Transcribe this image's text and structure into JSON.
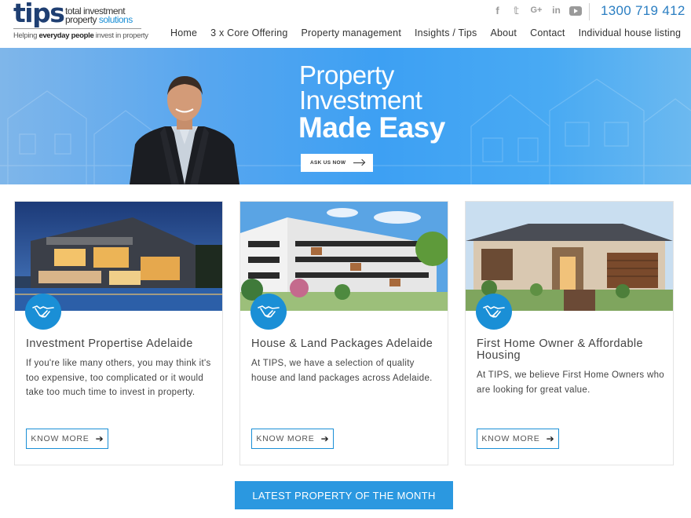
{
  "brand": {
    "logo_word": "tips",
    "logo_line1": "total investment",
    "logo_line2a": "property ",
    "logo_line2b": "solutions",
    "tagline_pre": "Helping ",
    "tagline_bold": "everyday people",
    "tagline_post": " invest in property",
    "accent_color": "#1a8fd6",
    "navy_color": "#1f3f72"
  },
  "social": [
    "facebook-icon",
    "twitter-icon",
    "google-plus-icon",
    "linkedin-icon",
    "youtube-icon"
  ],
  "social_glyphs": {
    "facebook": "f",
    "twitter": "𝕥",
    "google": "G+",
    "linkedin": "in"
  },
  "phone": "1300 719 412",
  "nav": {
    "items": [
      "Home",
      "3 x Core Offering",
      "Property management",
      "Insights / Tips",
      "About",
      "Contact",
      "Individual house listing"
    ]
  },
  "hero": {
    "title_line1": "Property",
    "title_line2": "Investment",
    "title_line3": "Made Easy",
    "button_label": "ASK US NOW"
  },
  "cards": [
    {
      "title": "Investment Propertise Adelaide",
      "text": "If you're like many others, you may think it's too expensive, too complicated or it would take too much time to invest in property.",
      "button": "KNOW MORE",
      "icon": "handshake-icon"
    },
    {
      "title": "House & Land Packages Adelaide",
      "text": "At TIPS, we have a selection of quality house and land packages across Adelaide.",
      "button": "KNOW MORE",
      "icon": "handshake-icon"
    },
    {
      "title": "First Home Owner & Affordable Housing",
      "text": "At TIPS, we believe First Home Owners who are looking for great value.",
      "button": "KNOW MORE",
      "icon": "handshake-icon"
    }
  ],
  "cta": {
    "label": "LATEST PROPERTY OF THE MONTH"
  }
}
